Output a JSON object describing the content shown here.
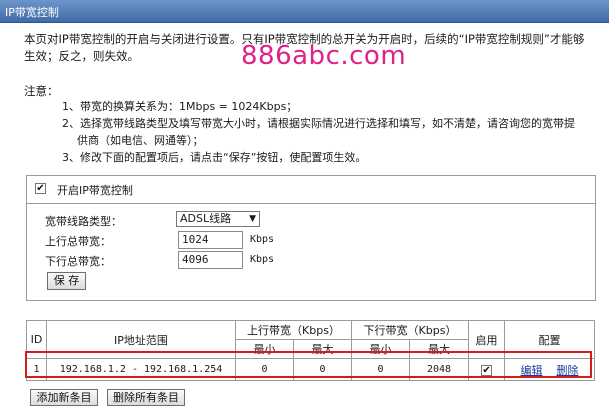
{
  "titlebar": {
    "title": "IP带宽控制"
  },
  "intro": {
    "line1": "本页对IP带宽控制的开启与关闭进行设置。只有IP带宽控制的总开关为开启时，后续的“IP带宽控制规则”才能够",
    "line2": "生效；反之，则失效。"
  },
  "watermark": "886abc.com",
  "notes": {
    "title": "注意：",
    "items": [
      "1、带宽的换算关系为：1Mbps = 1024Kbps；",
      "2、选择宽带线路类型及填写带宽大小时，请根据实际情况进行选择和填写，如不清楚，请咨询您的宽带提",
      "供商（如电信、网通等）；",
      "3、修改下面的配置项后，请点击“保存”按钮，使配置项生效。"
    ]
  },
  "settings": {
    "enable_label": "开启IP带宽控制",
    "enable_checked": true,
    "line_type_label": "宽带线路类型：",
    "line_type_value": "ADSL线路",
    "up_label": "上行总带宽：",
    "up_value": "1024",
    "down_label": "下行总带宽：",
    "down_value": "4096",
    "unit": "Kbps",
    "save_label": "保 存"
  },
  "table": {
    "headers": {
      "id": "ID",
      "ip_range": "IP地址范围",
      "up": "上行带宽（Kbps）",
      "down": "下行带宽（Kbps）",
      "enable": "启用",
      "config": "配置",
      "min": "最小",
      "max": "最大"
    },
    "rows": [
      {
        "id": "1",
        "ip_range": "192.168.1.2 - 192.168.1.254",
        "up_min": "0",
        "up_max": "0",
        "down_min": "0",
        "down_max": "2048",
        "enabled": true,
        "edit": "编辑",
        "delete": "删除"
      }
    ]
  },
  "actions": {
    "add_label": "添加新条目",
    "delete_all_label": "删除所有条目"
  },
  "colors": {
    "titlebar": "#4a78b5",
    "watermark": "#e0218a",
    "highlight": "#d71a1a",
    "link": "#1a3c9c"
  }
}
